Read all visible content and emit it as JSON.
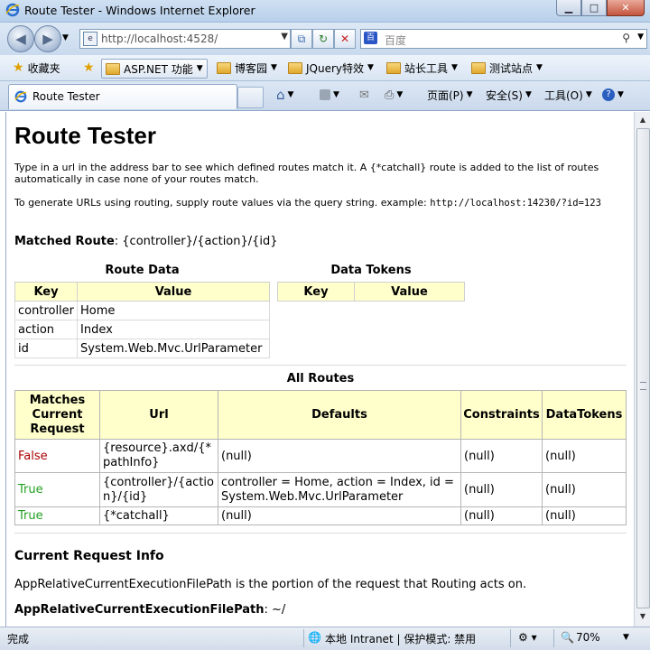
{
  "window": {
    "title": "Route Tester - Windows Internet Explorer"
  },
  "nav": {
    "url": "http://localhost:4528/",
    "search_placeholder": "百度"
  },
  "favorites": {
    "label": "收藏夹",
    "items": [
      "ASP.NET 功能",
      "博客园",
      "JQuery特效",
      "站长工具",
      "测试站点"
    ]
  },
  "tab": {
    "label": "Route Tester"
  },
  "commands": {
    "page": "页面(P)",
    "safety": "安全(S)",
    "tools": "工具(O)"
  },
  "page": {
    "title": "Route Tester",
    "intro": "Type in a url in the address bar to see which defined routes match it. A {*catchall} route is added to the list of routes automatically in case none of your routes match.",
    "generate_text": "To generate URLs using routing, supply route values via the query string. example: ",
    "generate_example": "http://localhost:14230/?id=123",
    "matched_label": "Matched Route",
    "matched_value": ": {controller}/{action}/{id}",
    "route_data": {
      "caption": "Route Data",
      "headers": [
        "Key",
        "Value"
      ],
      "rows": [
        [
          "controller",
          "Home"
        ],
        [
          "action",
          "Index"
        ],
        [
          "id",
          "System.Web.Mvc.UrlParameter"
        ]
      ]
    },
    "data_tokens": {
      "caption": "Data Tokens",
      "headers": [
        "Key",
        "Value"
      ]
    },
    "all_routes": {
      "caption": "All Routes",
      "headers": [
        "Matches Current Request",
        "Url",
        "Defaults",
        "Constraints",
        "DataTokens"
      ],
      "rows": [
        {
          "match": "False",
          "url": "{resource}.axd/{*pathInfo}",
          "defaults": "(null)",
          "constraints": "(null)",
          "tokens": "(null)"
        },
        {
          "match": "True",
          "url": "{controller}/{action}/{id}",
          "defaults": "controller = Home, action = Index, id = System.Web.Mvc.UrlParameter",
          "constraints": "(null)",
          "tokens": "(null)"
        },
        {
          "match": "True",
          "url": "{*catchall}",
          "defaults": "(null)",
          "constraints": "(null)",
          "tokens": "(null)"
        }
      ]
    },
    "current_request": {
      "heading": "Current Request Info",
      "desc": "AppRelativeCurrentExecutionFilePath is the portion of the request that Routing acts on.",
      "label": "AppRelativeCurrentExecutionFilePath",
      "value": ": ~/"
    }
  },
  "status": {
    "text": "完成",
    "zone": "本地 Intranet | 保护模式: 禁用",
    "zoom": "70%"
  },
  "colors": {
    "header_bg": "#ffffcc",
    "false": "#aa0000",
    "true": "#22a022"
  }
}
